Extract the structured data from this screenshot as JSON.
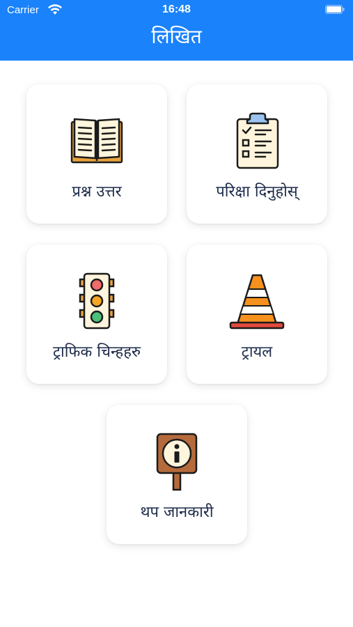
{
  "status_bar": {
    "carrier": "Carrier",
    "time": "16:48"
  },
  "header": {
    "title": "लिखित"
  },
  "menu": {
    "items": [
      {
        "label": "प्रश्न उत्तर",
        "icon": "open-book-icon"
      },
      {
        "label": "परिक्षा दिनुहोस्",
        "icon": "clipboard-checklist-icon"
      },
      {
        "label": "ट्राफिक चिन्हहरु",
        "icon": "traffic-light-icon"
      },
      {
        "label": "ट्रायल",
        "icon": "traffic-cone-icon"
      },
      {
        "label": "थप जानकारी",
        "icon": "info-sign-icon"
      }
    ]
  },
  "colors": {
    "header_bg": "#1a82fb",
    "label_text": "#1c2b4a"
  }
}
